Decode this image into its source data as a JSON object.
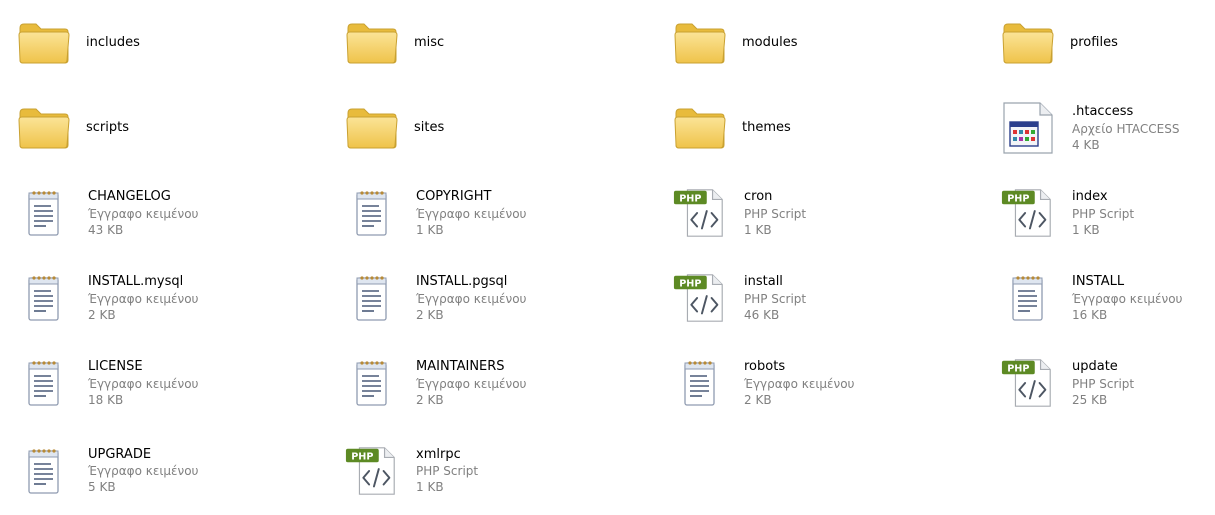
{
  "items": [
    {
      "name": "includes",
      "kind": "folder"
    },
    {
      "name": "misc",
      "kind": "folder"
    },
    {
      "name": "modules",
      "kind": "folder"
    },
    {
      "name": "profiles",
      "kind": "folder"
    },
    {
      "name": "scripts",
      "kind": "folder"
    },
    {
      "name": "sites",
      "kind": "folder"
    },
    {
      "name": "themes",
      "kind": "folder"
    },
    {
      "name": ".htaccess",
      "kind": "htaccess",
      "type": "Αρχείο HTACCESS",
      "size": "4 KB"
    },
    {
      "name": "CHANGELOG",
      "kind": "txt",
      "type": "Έγγραφο κειμένου",
      "size": "43 KB"
    },
    {
      "name": "COPYRIGHT",
      "kind": "txt",
      "type": "Έγγραφο κειμένου",
      "size": "1 KB"
    },
    {
      "name": "cron",
      "kind": "php",
      "type": "PHP Script",
      "size": "1 KB"
    },
    {
      "name": "index",
      "kind": "php",
      "type": "PHP Script",
      "size": "1 KB"
    },
    {
      "name": "INSTALL.mysql",
      "kind": "txt",
      "type": "Έγγραφο κειμένου",
      "size": "2 KB"
    },
    {
      "name": "INSTALL.pgsql",
      "kind": "txt",
      "type": "Έγγραφο κειμένου",
      "size": "2 KB"
    },
    {
      "name": "install",
      "kind": "php",
      "type": "PHP Script",
      "size": "46 KB"
    },
    {
      "name": "INSTALL",
      "kind": "txt",
      "type": "Έγγραφο κειμένου",
      "size": "16 KB"
    },
    {
      "name": "LICENSE",
      "kind": "txt",
      "type": "Έγγραφο κειμένου",
      "size": "18 KB"
    },
    {
      "name": "MAINTAINERS",
      "kind": "txt",
      "type": "Έγγραφο κειμένου",
      "size": "2 KB"
    },
    {
      "name": "robots",
      "kind": "txt",
      "type": "Έγγραφο κειμένου",
      "size": "2 KB"
    },
    {
      "name": "update",
      "kind": "php",
      "type": "PHP Script",
      "size": "25 KB"
    },
    {
      "name": "UPGRADE",
      "kind": "txt",
      "type": "Έγγραφο κειμένου",
      "size": "5 KB"
    },
    {
      "name": "xmlrpc",
      "kind": "php",
      "type": "PHP Script",
      "size": "1 KB"
    }
  ],
  "icons": {
    "folder": "folder-icon",
    "txt": "text-document-icon",
    "php": "php-script-icon",
    "htaccess": "htaccess-file-icon"
  },
  "badges": {
    "php": "PHP"
  },
  "colors": {
    "folder_fill": "#f7d567",
    "folder_edge": "#c9a131",
    "php_badge": "#5d8a24",
    "secondary_text": "#808080"
  }
}
